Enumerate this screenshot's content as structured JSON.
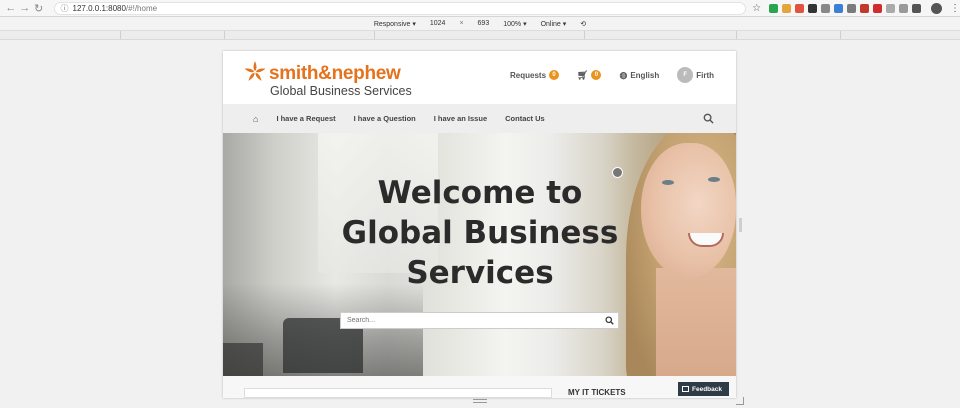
{
  "browser": {
    "url_host": "127.0.0.1:8080",
    "url_path": "/#!/home",
    "device_toolbar": {
      "mode": "Responsive ▾",
      "width": "1024",
      "times": "×",
      "height": "693",
      "zoom": "100% ▾",
      "network": "Online ▾"
    }
  },
  "site": {
    "logo": {
      "brand": "smith&nephew",
      "subtitle": "Global Business Services",
      "accent": "#e5721d"
    },
    "header_links": {
      "requests_label": "Requests",
      "requests_count": "0",
      "cart_count": "0",
      "language": "English",
      "avatar_initial": "F",
      "user_name": "Firth"
    },
    "nav": {
      "items": [
        "I have a Request",
        "I have a Question",
        "I have an Issue",
        "Contact Us"
      ]
    },
    "hero": {
      "title_line1": "Welcome to",
      "title_line2": "Global Business",
      "title_line3": "Services",
      "search_placeholder": "Search..."
    },
    "lower": {
      "tickets_heading": "MY IT TICKETS",
      "feedback_label": "Feedback"
    }
  }
}
